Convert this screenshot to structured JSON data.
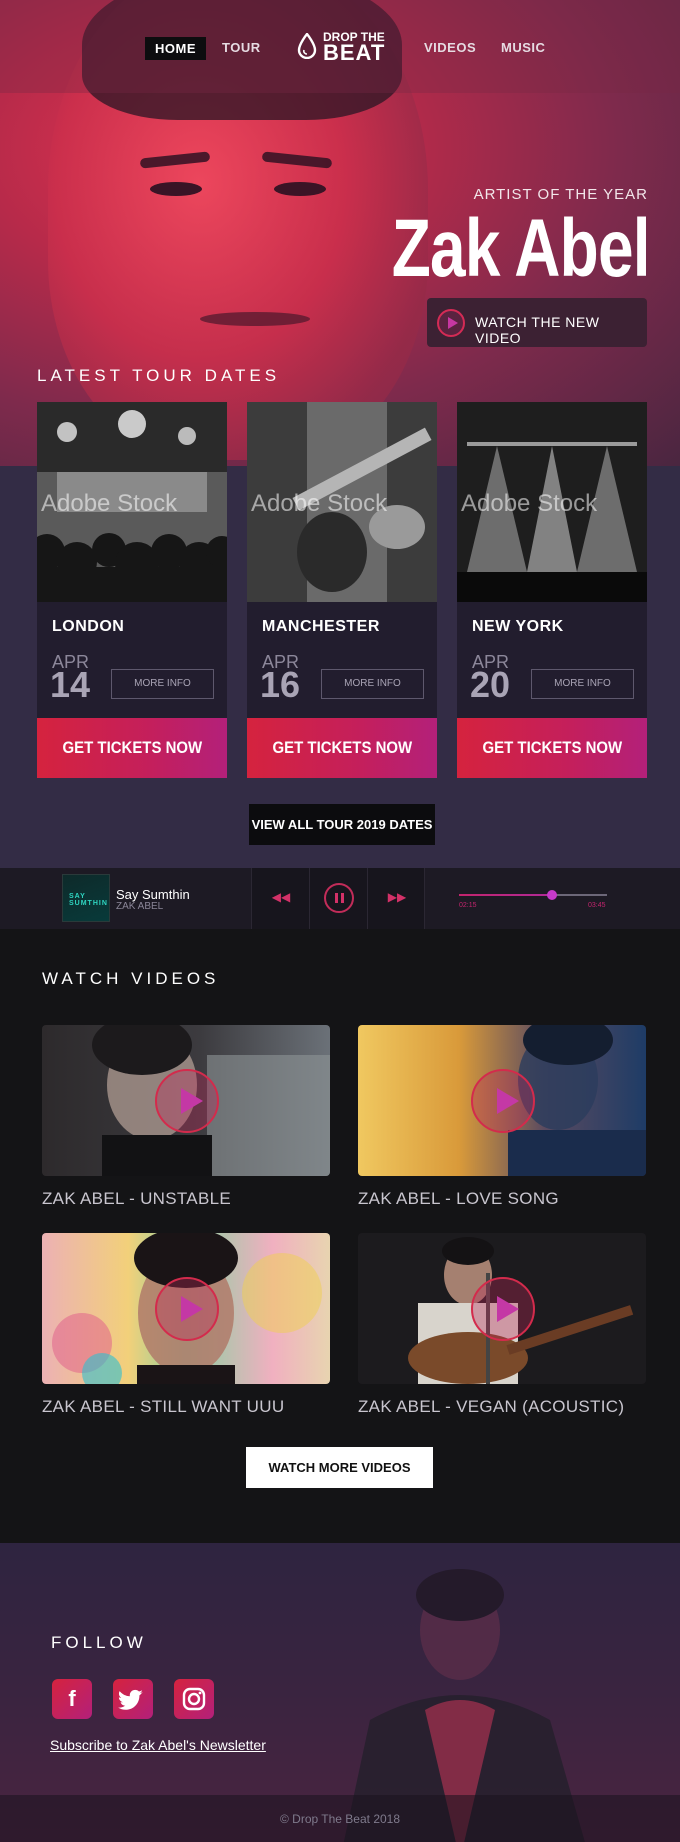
{
  "nav": {
    "items": [
      "HOME",
      "TOUR",
      "VIDEOS",
      "MUSIC"
    ],
    "logo_top": "DROP THE",
    "logo_bottom": "BEAT"
  },
  "hero": {
    "subtitle": "ARTIST OF THE YEAR",
    "title": "Zak Abel",
    "video_button": "WATCH THE NEW VIDEO"
  },
  "tour": {
    "heading": "LATEST TOUR DATES",
    "watermark": "Adobe Stock",
    "dates": [
      {
        "city": "LONDON",
        "month": "APR",
        "day": "14",
        "more": "MORE INFO",
        "tickets": "GET TICKETS NOW"
      },
      {
        "city": "MANCHESTER",
        "month": "APR",
        "day": "16",
        "more": "MORE INFO",
        "tickets": "GET TICKETS NOW"
      },
      {
        "city": "NEW YORK",
        "month": "APR",
        "day": "20",
        "more": "MORE INFO",
        "tickets": "GET TICKETS NOW"
      }
    ],
    "all_dates_button": "VIEW ALL TOUR 2019 DATES"
  },
  "player": {
    "cover_text": "SAY SUMTHIN",
    "track": "Say Sumthin",
    "artist": "ZAK ABEL",
    "current_time": "02:15",
    "total_time": "03:45",
    "progress": 0.63,
    "icons": [
      "rewind-icon",
      "pause-icon",
      "fast-forward-icon"
    ]
  },
  "videos": {
    "heading": "WATCH VIDEOS",
    "items": [
      {
        "title": "ZAK ABEL - UNSTABLE"
      },
      {
        "title": "ZAK ABEL - LOVE SONG"
      },
      {
        "title": "ZAK ABEL - STILL WANT UUU"
      },
      {
        "title": "ZAK ABEL - VEGAN (ACOUSTIC)"
      }
    ],
    "more_button": "WATCH MORE VIDEOS"
  },
  "follow": {
    "heading": "FOLLOW",
    "social": [
      "facebook-icon",
      "twitter-icon",
      "instagram-icon"
    ],
    "newsletter": "Subscribe to Zak Abel's Newsletter"
  },
  "footer": {
    "copyright": "© Drop The Beat 2018"
  },
  "colors": {
    "accent_red": "#d5233e",
    "accent_magenta": "#b3207a",
    "panel_dark": "#221d2e",
    "section_bg": "#332c45"
  }
}
